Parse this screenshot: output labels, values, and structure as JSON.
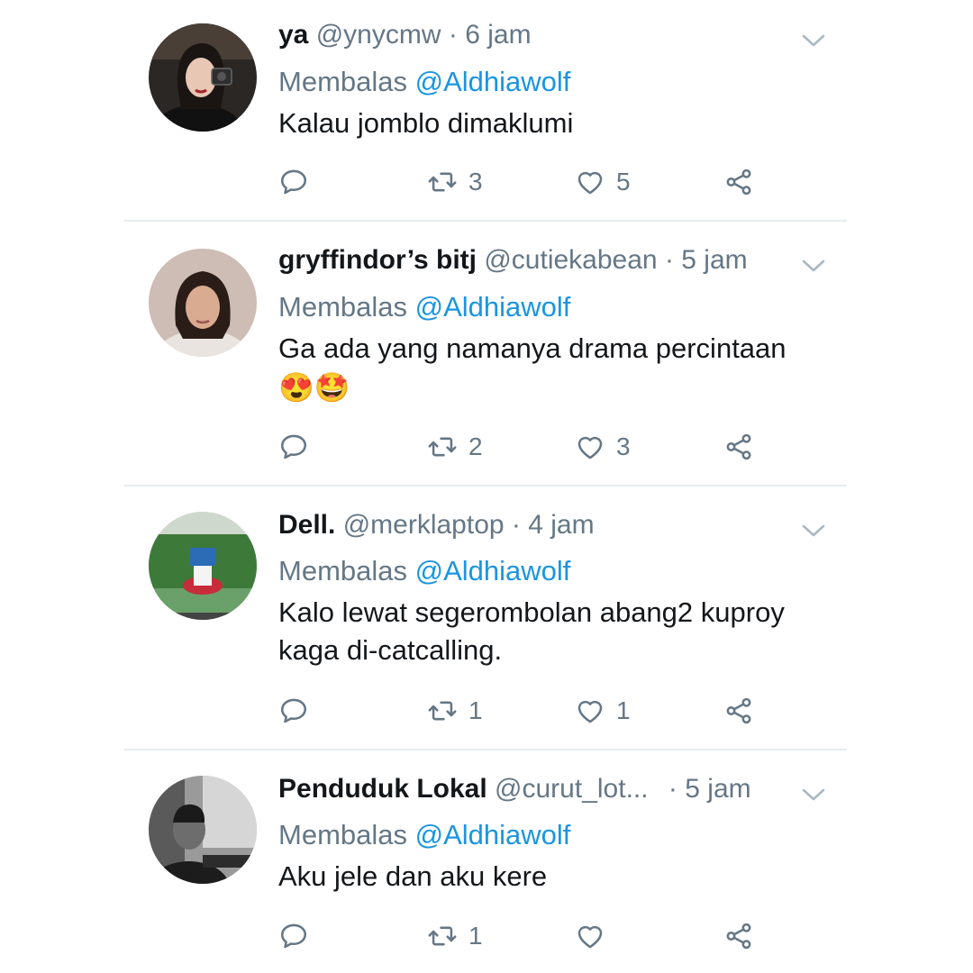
{
  "tweets": [
    {
      "name": "ya",
      "handle": "@ynycmw",
      "time": "6 jam",
      "reply_prefix": "Membalas",
      "reply_to": "@Aldhiawolf",
      "text": "Kalau jomblo dimaklumi",
      "emoji": "",
      "retweets": "3",
      "likes": "5"
    },
    {
      "name": "gryffindor’s bitj",
      "handle": "@cutiekabean",
      "time": "5 jam",
      "reply_prefix": "Membalas",
      "reply_to": "@Aldhiawolf",
      "text": "Ga ada yang namanya drama percintaan",
      "emoji": "😍🤩",
      "retweets": "2",
      "likes": "3"
    },
    {
      "name": "Dell.",
      "handle": "@merklaptop",
      "time": "4 jam",
      "reply_prefix": "Membalas",
      "reply_to": "@Aldhiawolf",
      "text": "Kalo lewat segerombolan abang2 kuproy kaga di-catcalling.",
      "emoji": "",
      "retweets": "1",
      "likes": "1"
    },
    {
      "name": "Penduduk Lokal",
      "handle": "@curut_lot...",
      "time": "5 jam",
      "reply_prefix": "Membalas",
      "reply_to": "@Aldhiawolf",
      "text": "Aku jele dan aku kere",
      "emoji": "",
      "retweets": "1",
      "likes": ""
    }
  ],
  "icons": {
    "reply": "reply-icon",
    "retweet": "retweet-icon",
    "like": "heart-icon",
    "share": "share-icon",
    "menu": "chevron-down-icon"
  },
  "colors": {
    "text": "#14171a",
    "muted": "#657786",
    "link": "#1b95e0",
    "divider": "#e6ecf0"
  }
}
